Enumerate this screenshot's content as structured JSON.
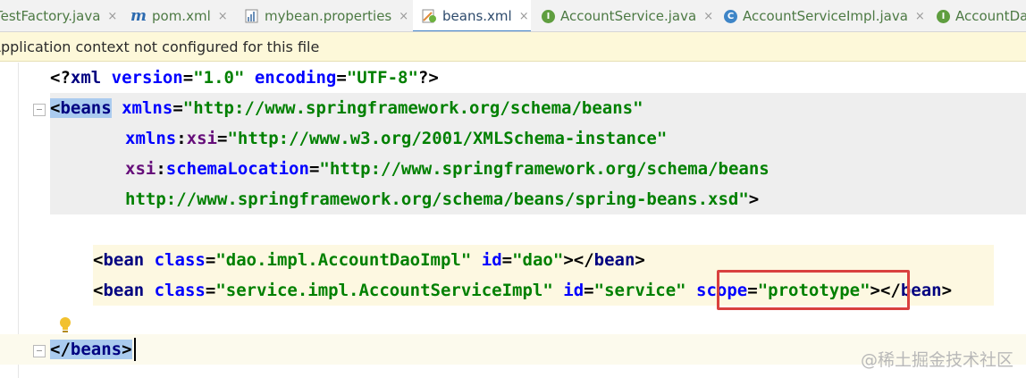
{
  "tabs": [
    {
      "label": "TestFactory.java",
      "icon": "java-class-icon",
      "active": false
    },
    {
      "label": "pom.xml",
      "icon": "maven-icon",
      "active": false
    },
    {
      "label": "mybean.properties",
      "icon": "properties-file-icon",
      "active": false
    },
    {
      "label": "beans.xml",
      "icon": "spring-xml-icon",
      "active": true
    },
    {
      "label": "AccountService.java",
      "icon": "interface-icon",
      "active": false
    },
    {
      "label": "AccountServiceImpl.java",
      "icon": "class-icon",
      "active": false
    },
    {
      "label": "AccountDa",
      "icon": "interface-icon",
      "active": false
    }
  ],
  "close_glyph": "×",
  "notice": {
    "text": "Application context not configured for this file"
  },
  "code": {
    "xml_decl": {
      "open": "<?",
      "name": "xml",
      "attr1": "version",
      "val1": "\"1.0\"",
      "attr2": "encoding",
      "val2": "\"UTF-8\"",
      "close": "?>"
    },
    "beans_open": {
      "bracket": "<",
      "tag": "beans",
      "attr": "xmlns",
      "val": "\"http://www.springframework.org/schema/beans\""
    },
    "xsi_line": {
      "ns": "xmlns",
      "colon": ":",
      "attr": "xsi",
      "val": "\"http://www.w3.org/2001/XMLSchema-instance\""
    },
    "schema_line": {
      "ns": "xsi",
      "colon": ":",
      "attr": "schemaLocation",
      "val": "\"http://www.springframework.org/schema/beans"
    },
    "schema_cont": {
      "val": "http://www.springframework.org/schema/beans/spring-beans.xsd\"",
      "close": ">"
    },
    "bean_dao": {
      "open": "<",
      "tag": "bean",
      "attr1": "class",
      "val1": "\"dao.impl.AccountDaoImpl\"",
      "attr2": "id",
      "val2": "\"dao\"",
      "close": "></",
      "tag2": "bean",
      "end": ">"
    },
    "bean_service": {
      "open": "<",
      "tag": "bean",
      "attr1": "class",
      "val1": "\"service.impl.AccountServiceImpl\"",
      "attr2": "id",
      "val2": "\"service\"",
      "attr3": "scope",
      "val3": "\"prototype\"",
      "close": "></",
      "tag2": "bean",
      "end": ">"
    },
    "beans_close": {
      "open": "</",
      "tag": "beans",
      "end": ">"
    }
  },
  "watermark": "@稀土掘金技术社区",
  "colors": {
    "tag": "#000080",
    "attr": "#0000ff",
    "value": "#008000",
    "highlight_box": "#d9413f"
  }
}
